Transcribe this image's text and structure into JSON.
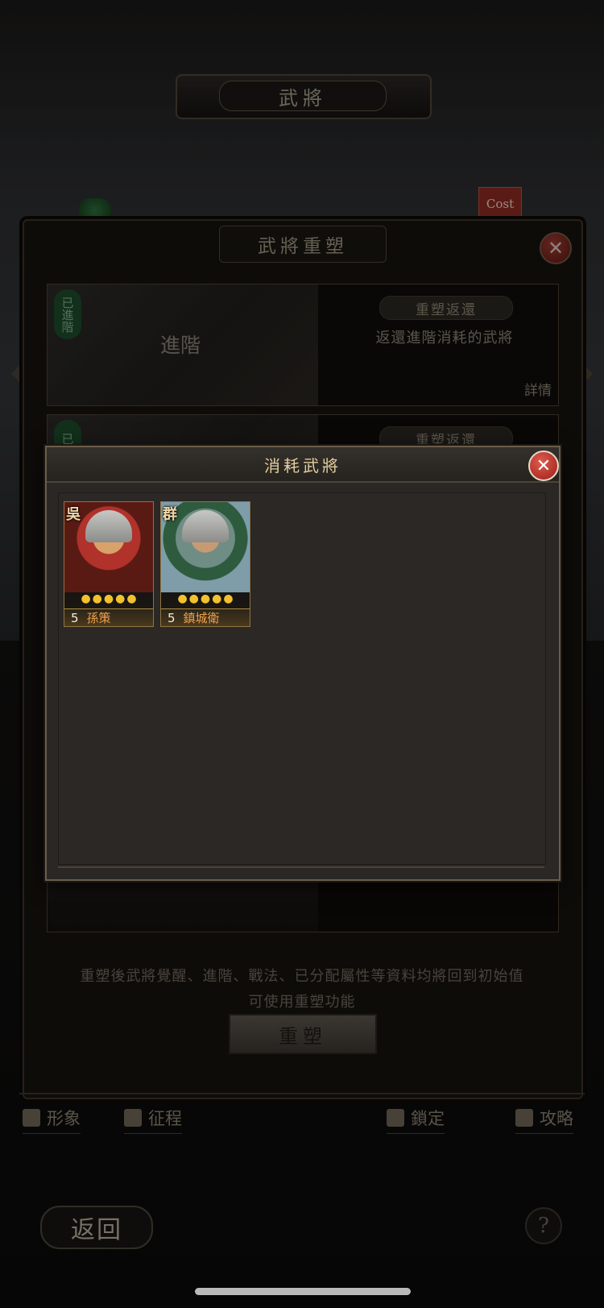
{
  "screen": {
    "title": "武將",
    "cost_tag": "Cost"
  },
  "reshape_panel": {
    "title": "武將重塑",
    "close_icon": "close-icon",
    "cards": [
      {
        "stamp": "已進階",
        "label": "進階",
        "badge": "重塑返還",
        "description": "返還進階消耗的武將",
        "detail": "詳情"
      },
      {
        "stamp": "已覺",
        "badge": "重塑返還"
      }
    ],
    "note_line1": "重塑後武將覺醒、進階、戰法、已分配屬性等資料均將回到初始值",
    "note_line2": "可使用重塑功能",
    "reshape_button": "重塑"
  },
  "bottom_tabs": [
    {
      "label": "形象",
      "icon": "person-icon"
    },
    {
      "label": "征程",
      "icon": "flag-icon"
    },
    {
      "label": "鎖定",
      "icon": "lock-icon"
    },
    {
      "label": "攻略",
      "icon": "book-icon"
    }
  ],
  "back_button": "返回",
  "help_button": "?",
  "modal": {
    "title": "消耗武將",
    "close_icon": "close-icon",
    "generals": [
      {
        "faction": "吳",
        "stars": 5,
        "cost": "5",
        "name": "孫策",
        "portrait": "wu"
      },
      {
        "faction": "群",
        "stars": 5,
        "cost": "5",
        "name": "鎮城衛",
        "portrait": "qun"
      }
    ]
  },
  "colors": {
    "modal_title": "#e3cfa0",
    "star": "#f2c12e",
    "close_red": "#c0392b"
  }
}
